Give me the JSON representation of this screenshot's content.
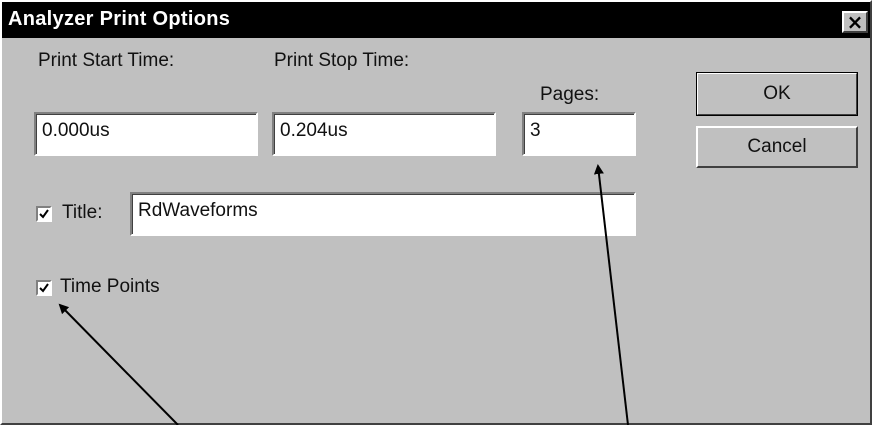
{
  "window": {
    "title": "Analyzer Print Options",
    "close_glyph": "×"
  },
  "fields": {
    "start_time": {
      "label": "Print Start Time:",
      "value": "0.000us"
    },
    "stop_time": {
      "label": "Print Stop Time:",
      "value": "0.204us"
    },
    "pages": {
      "label": "Pages:",
      "value": "3"
    }
  },
  "buttons": {
    "ok_label": "OK",
    "cancel_label": "Cancel"
  },
  "title_option": {
    "checked": true,
    "label": "Title:",
    "value": "RdWaveforms"
  },
  "time_points_option": {
    "checked": true,
    "label": "Time Points"
  },
  "colors": {
    "face": "#c0c0c0",
    "titlebar": "#000000",
    "annotation_arrow": "#000000"
  }
}
